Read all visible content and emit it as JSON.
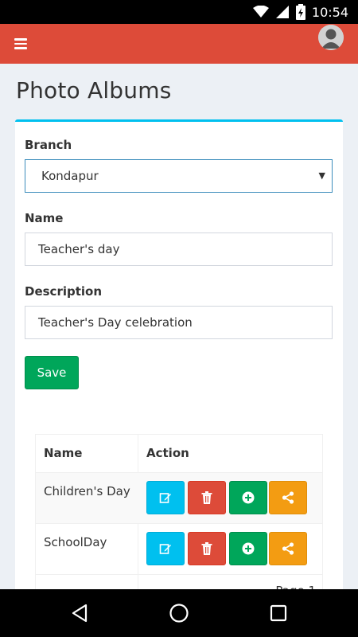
{
  "status_bar": {
    "time": "10:54",
    "icons": [
      "wifi-icon",
      "signal-icon",
      "battery-icon"
    ]
  },
  "header": {
    "menu_icon": "hamburger-icon",
    "avatar_icon": "user-avatar-icon",
    "color": "#dd4b39"
  },
  "page": {
    "title": "Photo Albums"
  },
  "form": {
    "branch_label": "Branch",
    "branch_value": "Kondapur",
    "name_label": "Name",
    "name_value": "Teacher's day",
    "description_label": "Description",
    "description_value": "Teacher's Day celebration",
    "save_label": "Save"
  },
  "table": {
    "headers": [
      "Name",
      "Action"
    ],
    "rows": [
      {
        "name": "Children's Day"
      },
      {
        "name": "SchoolDay"
      }
    ],
    "actions": [
      "edit-icon",
      "delete-icon",
      "add-icon",
      "share-icon"
    ],
    "pager_text": "Page 1"
  },
  "colors": {
    "accent": "#00c0ef",
    "danger": "#dd4b39",
    "success": "#00a65a",
    "warning": "#f39c12"
  }
}
